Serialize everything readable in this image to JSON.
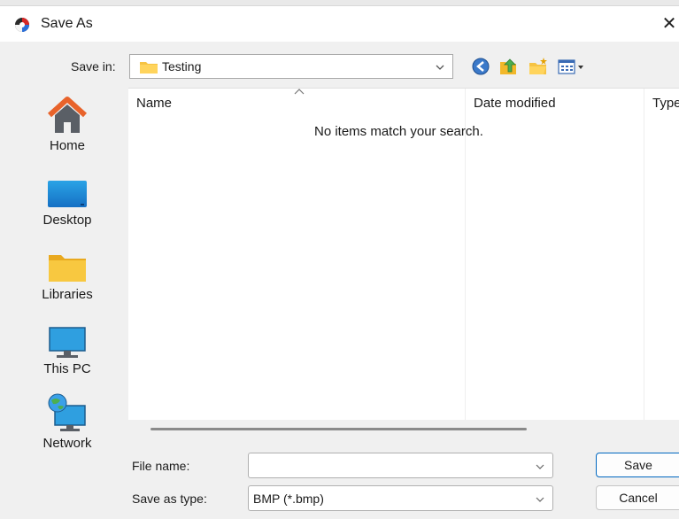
{
  "window": {
    "title": "Save As"
  },
  "save_in": {
    "label": "Save in:",
    "value": "Testing"
  },
  "places": [
    {
      "label": "Home"
    },
    {
      "label": "Desktop"
    },
    {
      "label": "Libraries"
    },
    {
      "label": "This PC"
    },
    {
      "label": "Network"
    }
  ],
  "file_list": {
    "columns": [
      {
        "label": "Name"
      },
      {
        "label": "Date modified"
      },
      {
        "label": "Type"
      }
    ],
    "empty_message": "No items match your search."
  },
  "file_name": {
    "label": "File name:",
    "value": "",
    "placeholder": ""
  },
  "save_as_type": {
    "label": "Save as type:",
    "value": "BMP (*.bmp)"
  },
  "buttons": {
    "save": "Save",
    "cancel": "Cancel"
  },
  "icons": {
    "app": "app-icon",
    "close": "close-icon",
    "back": "back-icon",
    "up": "up-folder-icon",
    "new_folder": "new-folder-icon",
    "view": "view-menu-icon"
  },
  "colors": {
    "accent": "#0067c0",
    "folder": "#f6c343",
    "list_bg": "#ffffff",
    "dialog_bg": "#f0f0f0"
  }
}
